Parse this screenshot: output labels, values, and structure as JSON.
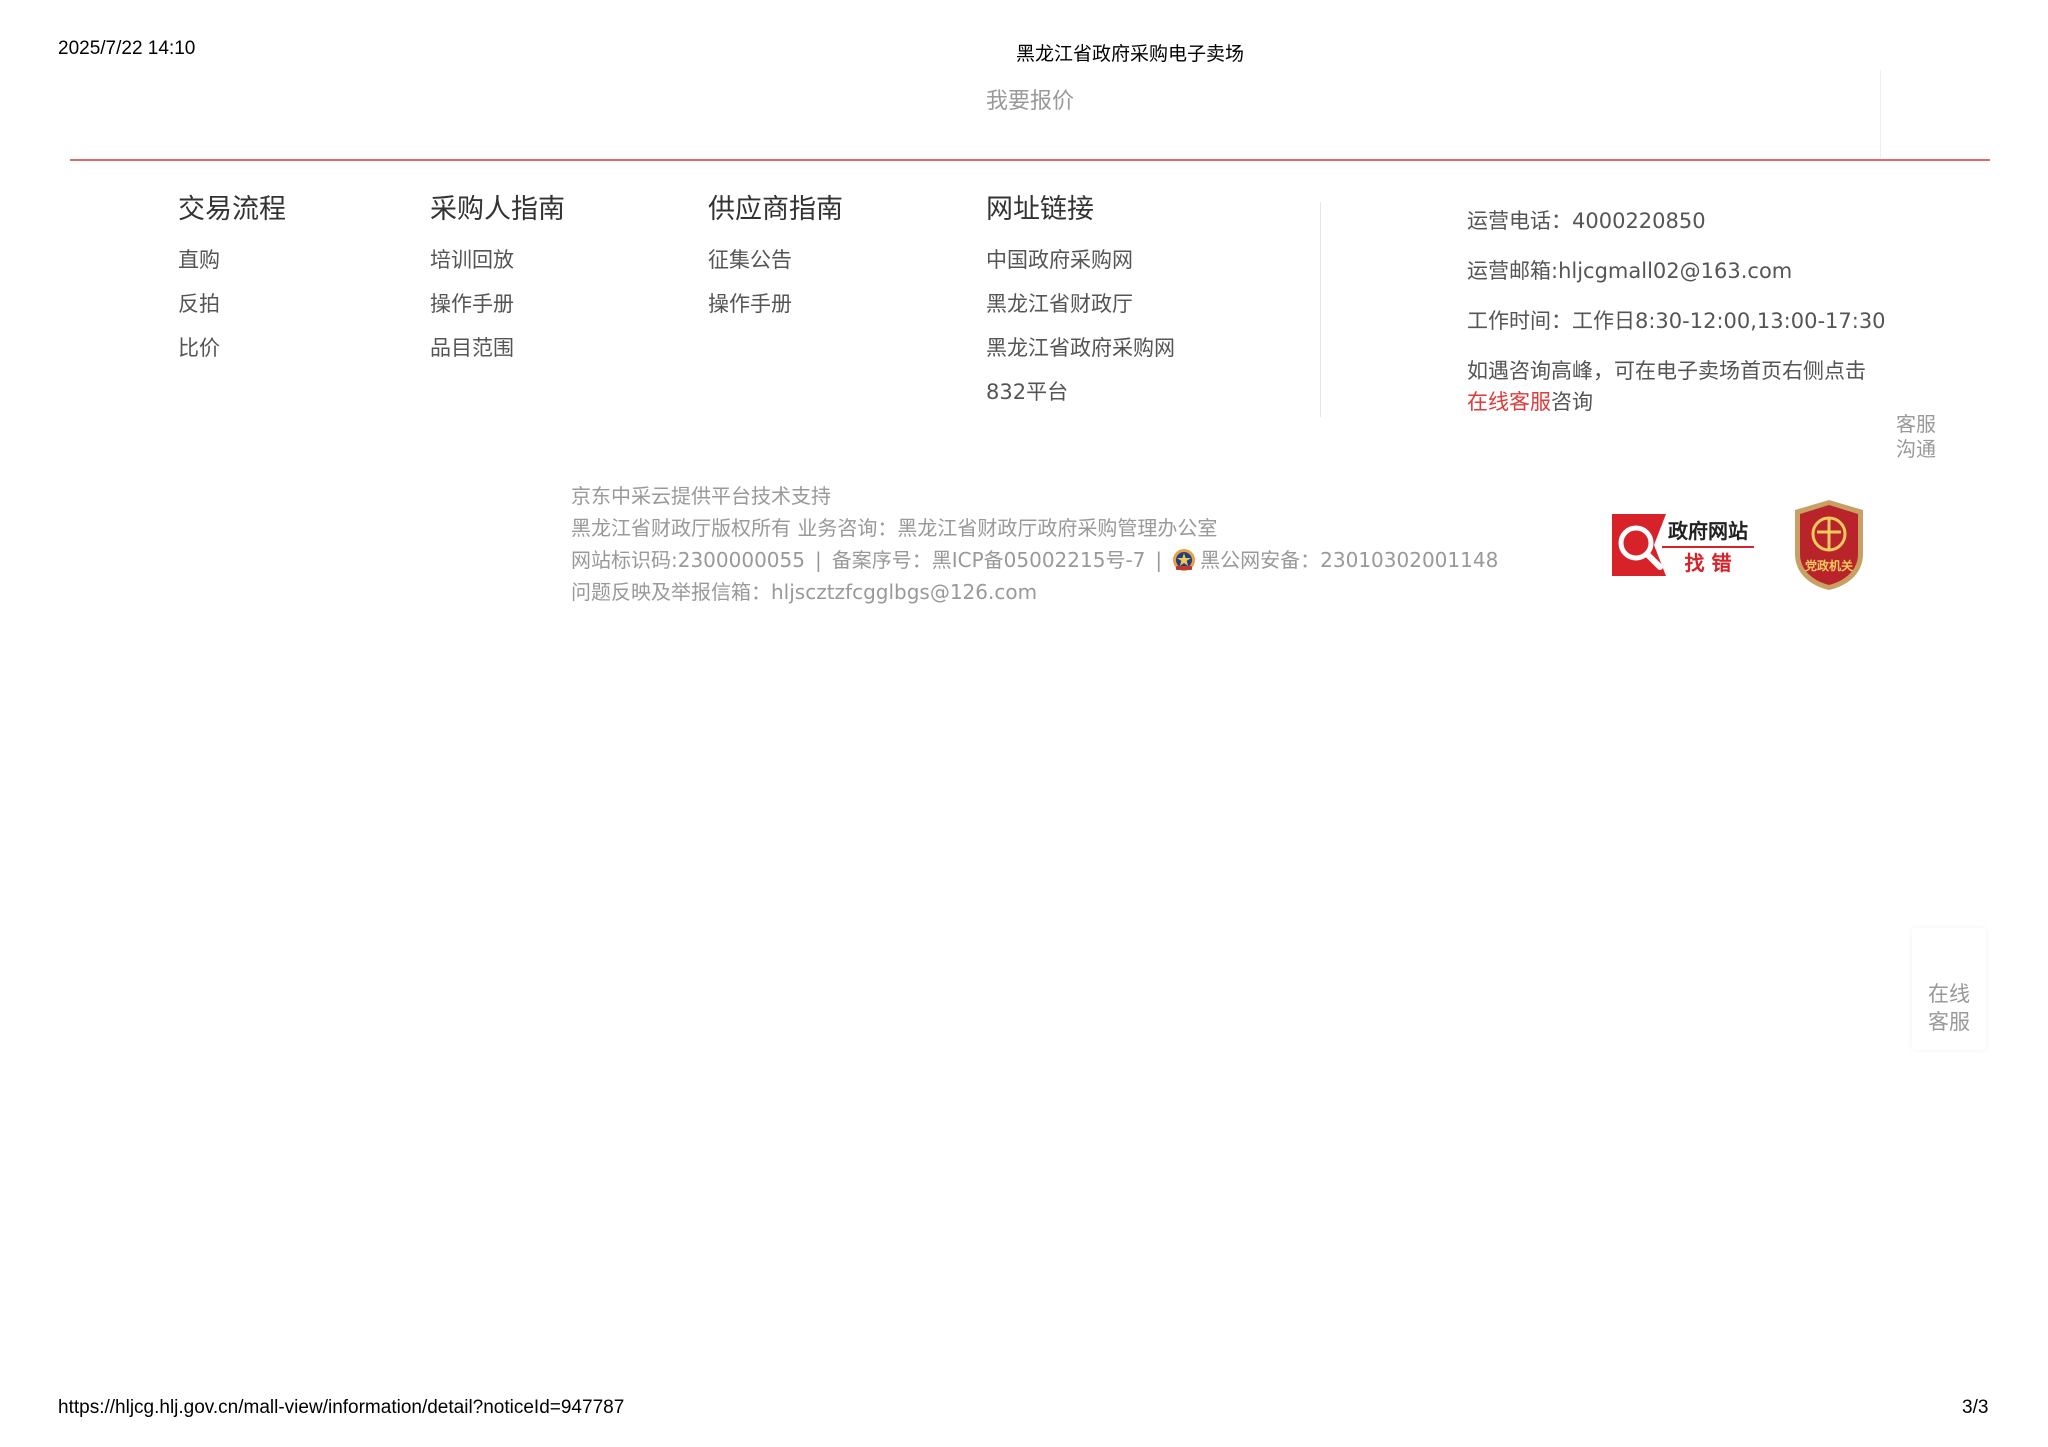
{
  "print_header": {
    "datetime": "2025/7/22 14:10",
    "title": "黑龙江省政府采购电子卖场"
  },
  "quote": {
    "label": "我要报价"
  },
  "footer_nav": [
    {
      "title": "交易流程",
      "links": [
        "直购",
        "反拍",
        "比价"
      ]
    },
    {
      "title": "采购人指南",
      "links": [
        "培训回放",
        "操作手册",
        "品目范围"
      ]
    },
    {
      "title": "供应商指南",
      "links": [
        "征集公告",
        "操作手册"
      ]
    },
    {
      "title": "网址链接",
      "links": [
        "中国政府采购网",
        "黑龙江省财政厅",
        "黑龙江省政府采购网",
        "832平台"
      ]
    }
  ],
  "contact": {
    "phone": "运营电话：4000220850",
    "email": "运营邮箱:hljcgmall02@163.com",
    "hours": "工作时间：工作日8:30-12:00,13:00-17:30",
    "peak_text": "如遇咨询高峰，可在电子卖场首页右侧点击",
    "online_service_link": "在线客服",
    "consult": "咨询"
  },
  "side": {
    "service_chat": [
      "客服",
      "沟通"
    ],
    "online_service": [
      "在线",
      "客服"
    ]
  },
  "credits": {
    "tech_support": "京东中采云提供平台技术支持",
    "copyright": "黑龙江省财政厅版权所有 业务咨询：黑龙江省财政厅政府采购管理办公室",
    "site_code": "网站标识码:2300000055",
    "separator": "|",
    "icp": "备案序号：黑ICP备05002215号-7",
    "police": "黑公网安备：23010302001148",
    "report_mail": "问题反映及举报信箱：hljscztzfcgglbgs@126.com"
  },
  "badges": {
    "find_error_top": "政府网站",
    "find_error_bottom": "找 错",
    "party_org": "党政机关"
  },
  "print_footer": {
    "url": "https://hljcg.hlj.gov.cn/mall-view/information/detail?noticeId=947787",
    "page": "3/3"
  },
  "colors": {
    "accent_red": "#e03a3a",
    "rule_red": "#e06a6a",
    "muted_text": "#999999"
  }
}
